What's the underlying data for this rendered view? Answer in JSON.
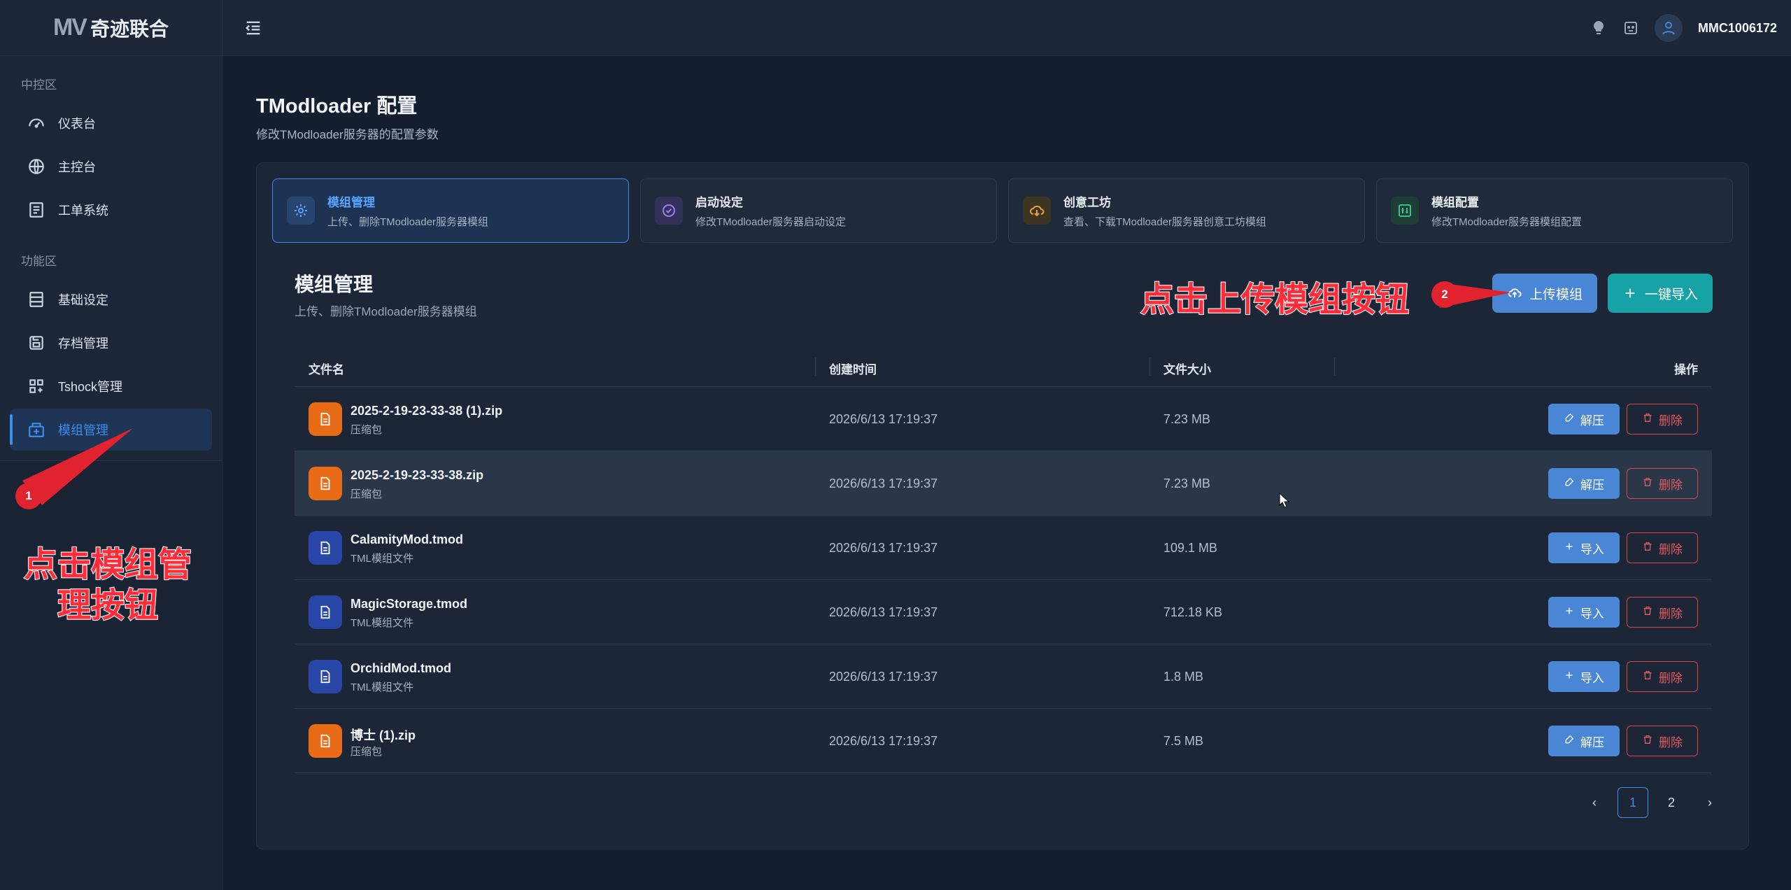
{
  "app": {
    "logo_mark": "MV",
    "logo_text": "奇迹联合",
    "username": "MMC1006172"
  },
  "sidebar": {
    "groups": [
      {
        "title": "中控区",
        "items": [
          {
            "label": "仪表台",
            "icon": "dashboard-icon"
          },
          {
            "label": "主控台",
            "icon": "globe-icon"
          },
          {
            "label": "工单系统",
            "icon": "ticket-icon"
          }
        ]
      },
      {
        "title": "功能区",
        "items": [
          {
            "label": "基础设定",
            "icon": "settings-list-icon"
          },
          {
            "label": "存档管理",
            "icon": "save-icon"
          },
          {
            "label": "Tshock管理",
            "icon": "grid-icon"
          },
          {
            "label": "模组管理",
            "icon": "mod-box-icon",
            "active": true
          }
        ]
      }
    ]
  },
  "page": {
    "title": "TModloader 配置",
    "subtitle": "修改TModloader服务器的配置参数"
  },
  "tabs": [
    {
      "title": "模组管理",
      "desc": "上传、删除TModloader服务器模组",
      "icon": "gear-icon",
      "active": true
    },
    {
      "title": "启动设定",
      "desc": "修改TModloader服务器启动设定",
      "icon": "check-circle-icon"
    },
    {
      "title": "创意工坊",
      "desc": "查看、下载TModloader服务器创意工坊模组",
      "icon": "cloud-download-icon"
    },
    {
      "title": "模组配置",
      "desc": "修改TModloader服务器模组配置",
      "icon": "sliders-icon"
    }
  ],
  "section": {
    "title": "模组管理",
    "subtitle": "上传、删除TModloader服务器模组",
    "upload_label": "上传模组",
    "import_all_label": "一键导入"
  },
  "table": {
    "headers": {
      "name": "文件名",
      "created": "创建时间",
      "size": "文件大小",
      "actions": "操作"
    },
    "rows": [
      {
        "name": "2025-2-19-23-33-38 (1).zip",
        "type": "压缩包",
        "kind": "zip",
        "created": "2026/6/13 17:19:37",
        "size": "7.23 MB",
        "action": "解压",
        "delete": "删除"
      },
      {
        "name": "2025-2-19-23-33-38.zip",
        "type": "压缩包",
        "kind": "zip",
        "created": "2026/6/13 17:19:37",
        "size": "7.23 MB",
        "action": "解压",
        "delete": "删除"
      },
      {
        "name": "CalamityMod.tmod",
        "type": "TML模组文件",
        "kind": "tmod",
        "created": "2026/6/13 17:19:37",
        "size": "109.1 MB",
        "action": "导入",
        "delete": "删除"
      },
      {
        "name": "MagicStorage.tmod",
        "type": "TML模组文件",
        "kind": "tmod",
        "created": "2026/6/13 17:19:37",
        "size": "712.18 KB",
        "action": "导入",
        "delete": "删除"
      },
      {
        "name": "OrchidMod.tmod",
        "type": "TML模组文件",
        "kind": "tmod",
        "created": "2026/6/13 17:19:37",
        "size": "1.8 MB",
        "action": "导入",
        "delete": "删除"
      },
      {
        "name": "博士 (1).zip",
        "type": "压缩包",
        "kind": "zip",
        "created": "2026/6/13 17:19:37",
        "size": "7.5 MB",
        "action": "解压",
        "delete": "删除"
      }
    ]
  },
  "pagination": {
    "prev": "‹",
    "pages": [
      "1",
      "2"
    ],
    "current": "1",
    "next": "›"
  },
  "annotations": {
    "step1_badge": "1",
    "step1_text_line1": "点击模组管",
    "step1_text_line2": "理按钮",
    "step2_badge": "2",
    "step2_text": "点击上传模组按钮"
  },
  "colors": {
    "accent": "#3b8df0",
    "upload": "#4a86d6",
    "import_all": "#17a2a6",
    "danger": "#e35a60",
    "annotation": "#ff2d3a"
  }
}
